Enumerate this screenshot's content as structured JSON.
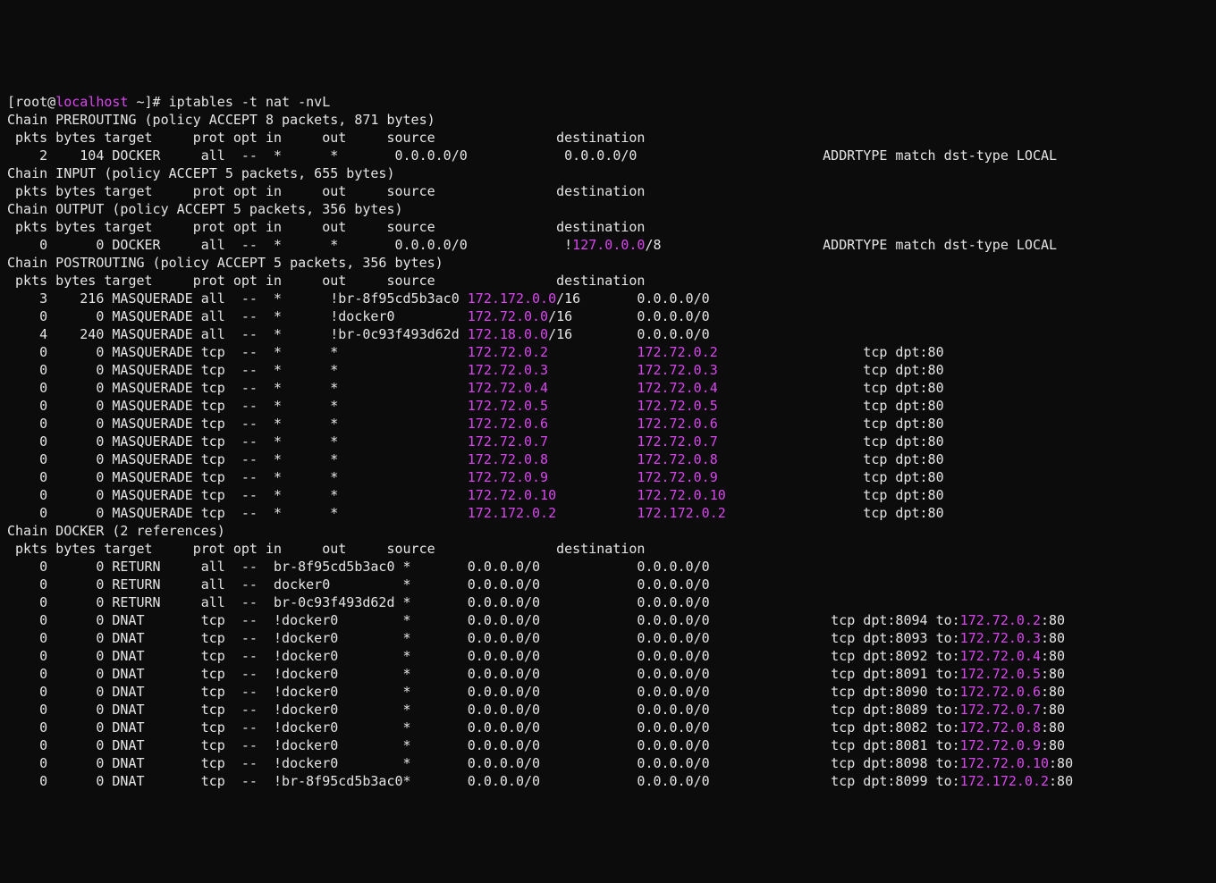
{
  "prompt": {
    "open": "[",
    "user": "root",
    "at": "@",
    "host": "localhost",
    "rest": " ~]# ",
    "cmd": "iptables -t nat -nvL"
  },
  "chains": [
    {
      "name": "PREROUTING",
      "policy": "policy ACCEPT 8 packets, 871 bytes",
      "header": " pkts bytes target     prot opt in     out     source               destination",
      "rows": [
        {
          "pkts": "2",
          "bytes": "104",
          "target": "DOCKER",
          "prot": "all",
          "opt": "--",
          "in": "*",
          "out": "*",
          "src": "0.0.0.0/0",
          "dst": "0.0.0.0/0",
          "extra": "ADDRTYPE match dst-type LOCAL"
        }
      ]
    },
    {
      "name": "INPUT",
      "policy": "policy ACCEPT 5 packets, 655 bytes",
      "header": " pkts bytes target     prot opt in     out     source               destination",
      "rows": []
    },
    {
      "name": "OUTPUT",
      "policy": "policy ACCEPT 5 packets, 356 bytes",
      "header": " pkts bytes target     prot opt in     out     source               destination",
      "rows": [
        {
          "pkts": "0",
          "bytes": "0",
          "target": "DOCKER",
          "prot": "all",
          "opt": "--",
          "in": "*",
          "out": "*",
          "src": "0.0.0.0/0",
          "dst_pre": "!",
          "dst_hl": "127.0.0.0",
          "dst_post": "/8",
          "extra": "ADDRTYPE match dst-type LOCAL"
        }
      ]
    },
    {
      "name": "POSTROUTING",
      "policy": "policy ACCEPT 5 packets, 356 bytes",
      "header": " pkts bytes target     prot opt in     out     source               destination",
      "rows": [
        {
          "pkts": "3",
          "bytes": "216",
          "target": "MASQUERADE",
          "prot": "all",
          "opt": "--",
          "in": "*",
          "out": "!br-8f95cd5b3ac0",
          "src_hl": "172.172.0.0",
          "src_post": "/16",
          "dst": "0.0.0.0/0"
        },
        {
          "pkts": "0",
          "bytes": "0",
          "target": "MASQUERADE",
          "prot": "all",
          "opt": "--",
          "in": "*",
          "out": "!docker0",
          "src_hl": "172.72.0.0",
          "src_post": "/16",
          "dst": "0.0.0.0/0"
        },
        {
          "pkts": "4",
          "bytes": "240",
          "target": "MASQUERADE",
          "prot": "all",
          "opt": "--",
          "in": "*",
          "out": "!br-0c93f493d62d",
          "src_hl": "172.18.0.0",
          "src_post": "/16",
          "dst": "0.0.0.0/0"
        },
        {
          "pkts": "0",
          "bytes": "0",
          "target": "MASQUERADE",
          "prot": "tcp",
          "opt": "--",
          "in": "*",
          "out": "*",
          "src_hl": "172.72.0.2",
          "dst_hl": "172.72.0.2",
          "extra": "tcp dpt:80"
        },
        {
          "pkts": "0",
          "bytes": "0",
          "target": "MASQUERADE",
          "prot": "tcp",
          "opt": "--",
          "in": "*",
          "out": "*",
          "src_hl": "172.72.0.3",
          "dst_hl": "172.72.0.3",
          "extra": "tcp dpt:80"
        },
        {
          "pkts": "0",
          "bytes": "0",
          "target": "MASQUERADE",
          "prot": "tcp",
          "opt": "--",
          "in": "*",
          "out": "*",
          "src_hl": "172.72.0.4",
          "dst_hl": "172.72.0.4",
          "extra": "tcp dpt:80"
        },
        {
          "pkts": "0",
          "bytes": "0",
          "target": "MASQUERADE",
          "prot": "tcp",
          "opt": "--",
          "in": "*",
          "out": "*",
          "src_hl": "172.72.0.5",
          "dst_hl": "172.72.0.5",
          "extra": "tcp dpt:80"
        },
        {
          "pkts": "0",
          "bytes": "0",
          "target": "MASQUERADE",
          "prot": "tcp",
          "opt": "--",
          "in": "*",
          "out": "*",
          "src_hl": "172.72.0.6",
          "dst_hl": "172.72.0.6",
          "extra": "tcp dpt:80"
        },
        {
          "pkts": "0",
          "bytes": "0",
          "target": "MASQUERADE",
          "prot": "tcp",
          "opt": "--",
          "in": "*",
          "out": "*",
          "src_hl": "172.72.0.7",
          "dst_hl": "172.72.0.7",
          "extra": "tcp dpt:80"
        },
        {
          "pkts": "0",
          "bytes": "0",
          "target": "MASQUERADE",
          "prot": "tcp",
          "opt": "--",
          "in": "*",
          "out": "*",
          "src_hl": "172.72.0.8",
          "dst_hl": "172.72.0.8",
          "extra": "tcp dpt:80"
        },
        {
          "pkts": "0",
          "bytes": "0",
          "target": "MASQUERADE",
          "prot": "tcp",
          "opt": "--",
          "in": "*",
          "out": "*",
          "src_hl": "172.72.0.9",
          "dst_hl": "172.72.0.9",
          "extra": "tcp dpt:80"
        },
        {
          "pkts": "0",
          "bytes": "0",
          "target": "MASQUERADE",
          "prot": "tcp",
          "opt": "--",
          "in": "*",
          "out": "*",
          "src_hl": "172.72.0.10",
          "dst_hl": "172.72.0.10",
          "extra": "tcp dpt:80"
        },
        {
          "pkts": "0",
          "bytes": "0",
          "target": "MASQUERADE",
          "prot": "tcp",
          "opt": "--",
          "in": "*",
          "out": "*",
          "src_hl": "172.172.0.2",
          "dst_hl": "172.172.0.2",
          "extra": "tcp dpt:80"
        }
      ]
    },
    {
      "name": "DOCKER",
      "refs": "2 references",
      "header": " pkts bytes target     prot opt in     out     source               destination",
      "rows": [
        {
          "pkts": "0",
          "bytes": "0",
          "target": "RETURN",
          "prot": "all",
          "opt": "--",
          "in": "br-8f95cd5b3ac0",
          "out": "*",
          "src": "0.0.0.0/0",
          "dst": "0.0.0.0/0"
        },
        {
          "pkts": "0",
          "bytes": "0",
          "target": "RETURN",
          "prot": "all",
          "opt": "--",
          "in": "docker0",
          "out": "*",
          "src": "0.0.0.0/0",
          "dst": "0.0.0.0/0"
        },
        {
          "pkts": "0",
          "bytes": "0",
          "target": "RETURN",
          "prot": "all",
          "opt": "--",
          "in": "br-0c93f493d62d",
          "out": "*",
          "src": "0.0.0.0/0",
          "dst": "0.0.0.0/0"
        },
        {
          "pkts": "0",
          "bytes": "0",
          "target": "DNAT",
          "prot": "tcp",
          "opt": "--",
          "in": "!docker0",
          "out": "*",
          "src": "0.0.0.0/0",
          "dst": "0.0.0.0/0",
          "extra_pre": "tcp dpt:8094 to:",
          "extra_hl": "172.72.0.2",
          "extra_post": ":80"
        },
        {
          "pkts": "0",
          "bytes": "0",
          "target": "DNAT",
          "prot": "tcp",
          "opt": "--",
          "in": "!docker0",
          "out": "*",
          "src": "0.0.0.0/0",
          "dst": "0.0.0.0/0",
          "extra_pre": "tcp dpt:8093 to:",
          "extra_hl": "172.72.0.3",
          "extra_post": ":80"
        },
        {
          "pkts": "0",
          "bytes": "0",
          "target": "DNAT",
          "prot": "tcp",
          "opt": "--",
          "in": "!docker0",
          "out": "*",
          "src": "0.0.0.0/0",
          "dst": "0.0.0.0/0",
          "extra_pre": "tcp dpt:8092 to:",
          "extra_hl": "172.72.0.4",
          "extra_post": ":80"
        },
        {
          "pkts": "0",
          "bytes": "0",
          "target": "DNAT",
          "prot": "tcp",
          "opt": "--",
          "in": "!docker0",
          "out": "*",
          "src": "0.0.0.0/0",
          "dst": "0.0.0.0/0",
          "extra_pre": "tcp dpt:8091 to:",
          "extra_hl": "172.72.0.5",
          "extra_post": ":80"
        },
        {
          "pkts": "0",
          "bytes": "0",
          "target": "DNAT",
          "prot": "tcp",
          "opt": "--",
          "in": "!docker0",
          "out": "*",
          "src": "0.0.0.0/0",
          "dst": "0.0.0.0/0",
          "extra_pre": "tcp dpt:8090 to:",
          "extra_hl": "172.72.0.6",
          "extra_post": ":80"
        },
        {
          "pkts": "0",
          "bytes": "0",
          "target": "DNAT",
          "prot": "tcp",
          "opt": "--",
          "in": "!docker0",
          "out": "*",
          "src": "0.0.0.0/0",
          "dst": "0.0.0.0/0",
          "extra_pre": "tcp dpt:8089 to:",
          "extra_hl": "172.72.0.7",
          "extra_post": ":80"
        },
        {
          "pkts": "0",
          "bytes": "0",
          "target": "DNAT",
          "prot": "tcp",
          "opt": "--",
          "in": "!docker0",
          "out": "*",
          "src": "0.0.0.0/0",
          "dst": "0.0.0.0/0",
          "extra_pre": "tcp dpt:8082 to:",
          "extra_hl": "172.72.0.8",
          "extra_post": ":80"
        },
        {
          "pkts": "0",
          "bytes": "0",
          "target": "DNAT",
          "prot": "tcp",
          "opt": "--",
          "in": "!docker0",
          "out": "*",
          "src": "0.0.0.0/0",
          "dst": "0.0.0.0/0",
          "extra_pre": "tcp dpt:8081 to:",
          "extra_hl": "172.72.0.9",
          "extra_post": ":80"
        },
        {
          "pkts": "0",
          "bytes": "0",
          "target": "DNAT",
          "prot": "tcp",
          "opt": "--",
          "in": "!docker0",
          "out": "*",
          "src": "0.0.0.0/0",
          "dst": "0.0.0.0/0",
          "extra_pre": "tcp dpt:8098 to:",
          "extra_hl": "172.72.0.10",
          "extra_post": ":80"
        },
        {
          "pkts": "0",
          "bytes": "0",
          "target": "DNAT",
          "prot": "tcp",
          "opt": "--",
          "in": "!br-8f95cd5b3ac0",
          "out": "*",
          "src": "0.0.0.0/0",
          "dst": "0.0.0.0/0",
          "extra_pre": "tcp dpt:8099 to:",
          "extra_hl": "172.172.0.2",
          "extra_post": ":80"
        }
      ]
    }
  ],
  "cols": {
    "pkts": 5,
    "bytes": 6,
    "target": 11,
    "prot": 5,
    "opt": 4,
    "in_docker": 16,
    "out_docker": 8,
    "in_post": 7,
    "out_post": 17,
    "in_std": 7,
    "out_std": 8,
    "src": 21,
    "dst": 21,
    "extra_pad_std": 11,
    "extra_pad_post": 7,
    "extra_pad_docker": 3
  }
}
